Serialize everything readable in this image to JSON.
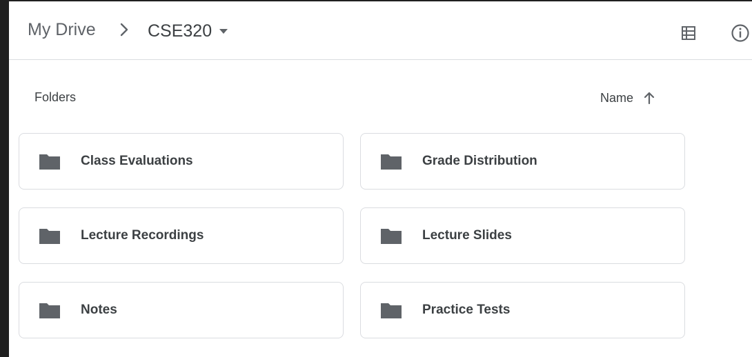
{
  "breadcrumb": {
    "root": "My Drive",
    "current": "CSE320"
  },
  "section": {
    "label": "Folders"
  },
  "sort": {
    "label": "Name"
  },
  "folders": [
    {
      "label": "Class Evaluations"
    },
    {
      "label": "Grade Distribution"
    },
    {
      "label": "Lecture Recordings"
    },
    {
      "label": "Lecture Slides"
    },
    {
      "label": "Notes"
    },
    {
      "label": "Practice Tests"
    }
  ],
  "icons": {
    "separator": "chevron-right-icon",
    "dropdown": "caret-down-icon",
    "view": "list-view-icon",
    "info": "info-icon",
    "sort": "arrow-up-icon",
    "folder": "folder-icon"
  },
  "colors": {
    "background": "#1f1f1f",
    "surface": "#ffffff",
    "border": "#dadce0",
    "text": "#3c4043",
    "muted": "#5f6368"
  }
}
